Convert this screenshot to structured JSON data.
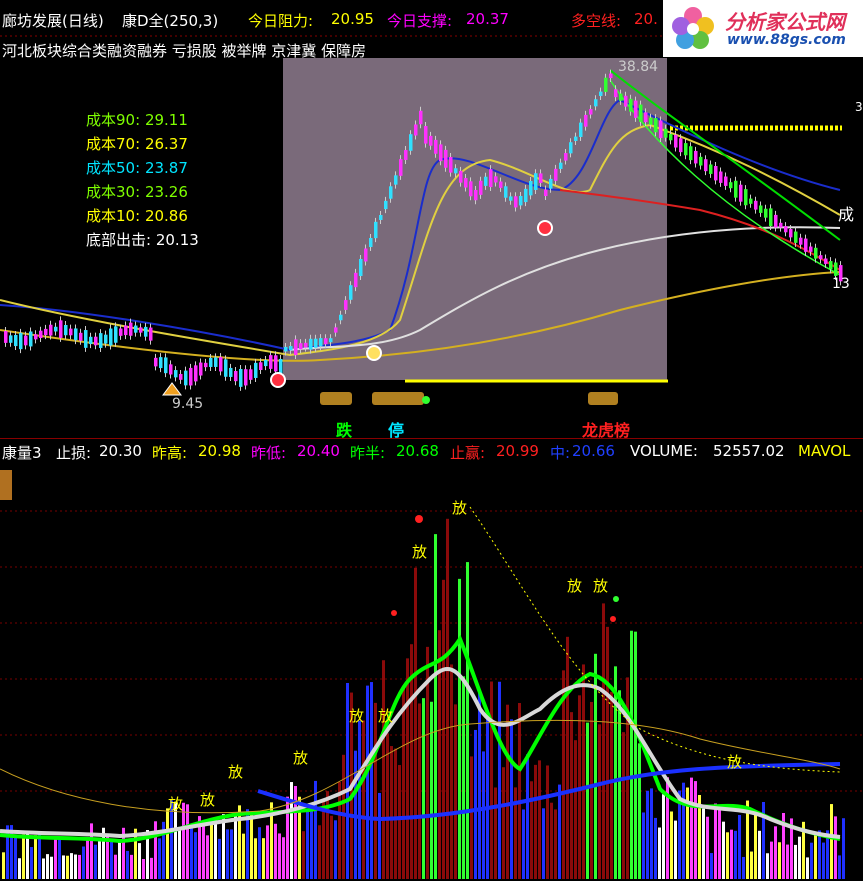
{
  "header": {
    "title": "廊坊发展(日线)",
    "indicator": "康D全(250,3)",
    "resistance_label": "今日阻力:",
    "resistance_value": "20.95",
    "support_label": "今日支撑:",
    "support_value": "20.37",
    "trend_label": "多空线:",
    "trend_value": "20."
  },
  "concepts": "河北板块综合类融资融券 亏损股 被举牌 京津冀 保障房",
  "costs": [
    {
      "label": "成本90:",
      "value": "29.11",
      "color": "#7fff00"
    },
    {
      "label": "成本70:",
      "value": "26.37",
      "color": "#ffff00"
    },
    {
      "label": "成本50:",
      "value": "23.87",
      "color": "#00e5ff"
    },
    {
      "label": "成本30:",
      "value": "23.26",
      "color": "#7fff00"
    },
    {
      "label": "成本10:",
      "value": "20.86",
      "color": "#ffff00"
    },
    {
      "label": "底部出击:",
      "value": "20.13",
      "color": "#ffffff"
    }
  ],
  "price_marks": {
    "high": "38.84",
    "low": "9.45",
    "end": "13",
    "right_char": "成",
    "right_edge": "3"
  },
  "event_tags": {
    "down": "跌",
    "halt": "停",
    "list": "龙虎榜"
  },
  "volume_header": {
    "name": "康量3",
    "stop_label": "止损:",
    "stop_value": "20.30",
    "prev_high_label": "昨高:",
    "prev_high_value": "20.98",
    "prev_low_label": "昨低:",
    "prev_low_value": "20.40",
    "prev_half_label": "昨半:",
    "prev_half_value": "20.68",
    "take_label": "止赢:",
    "take_value": "20.99",
    "mid_label": "中:",
    "mid_value": "20.66",
    "volume_label": "VOLUME:",
    "volume_value": "52557.02",
    "mavol_label": "MAVOL"
  },
  "volume_marks": [
    "放",
    "放",
    "放",
    "放",
    "放",
    "放",
    "放",
    "放",
    "放",
    "放",
    "放"
  ],
  "logo": {
    "title": "分析家公式网",
    "url": "www.88gs.com"
  },
  "colors": {
    "up": "#ff00ff",
    "down": "#00ffff",
    "green": "#00ff00",
    "yellow": "#ffff00",
    "red": "#ff2020",
    "blue": "#2040ff",
    "white": "#ffffff",
    "highlight_bg": "#7a6a7a"
  }
}
